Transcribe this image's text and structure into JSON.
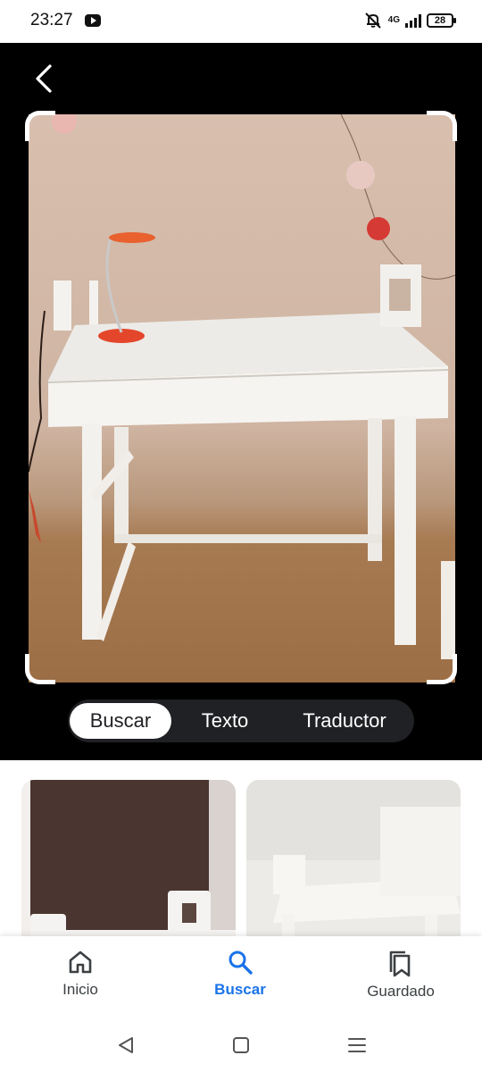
{
  "status_bar": {
    "time": "23:27",
    "network": "4G",
    "battery": "28"
  },
  "lens": {
    "back_icon": "chevron-left-icon",
    "tabs": [
      {
        "label": "Buscar",
        "active": true
      },
      {
        "label": "Texto",
        "active": false
      },
      {
        "label": "Traductor",
        "active": false
      }
    ]
  },
  "bottom_nav": {
    "items": [
      {
        "label": "Inicio",
        "icon": "home-icon",
        "active": false
      },
      {
        "label": "Buscar",
        "icon": "search-icon",
        "active": true
      },
      {
        "label": "Guardado",
        "icon": "bookmarks-icon",
        "active": false
      }
    ]
  },
  "colors": {
    "accent": "#1a73e8",
    "tab_bar": "#202124",
    "background_dark": "#000000"
  }
}
